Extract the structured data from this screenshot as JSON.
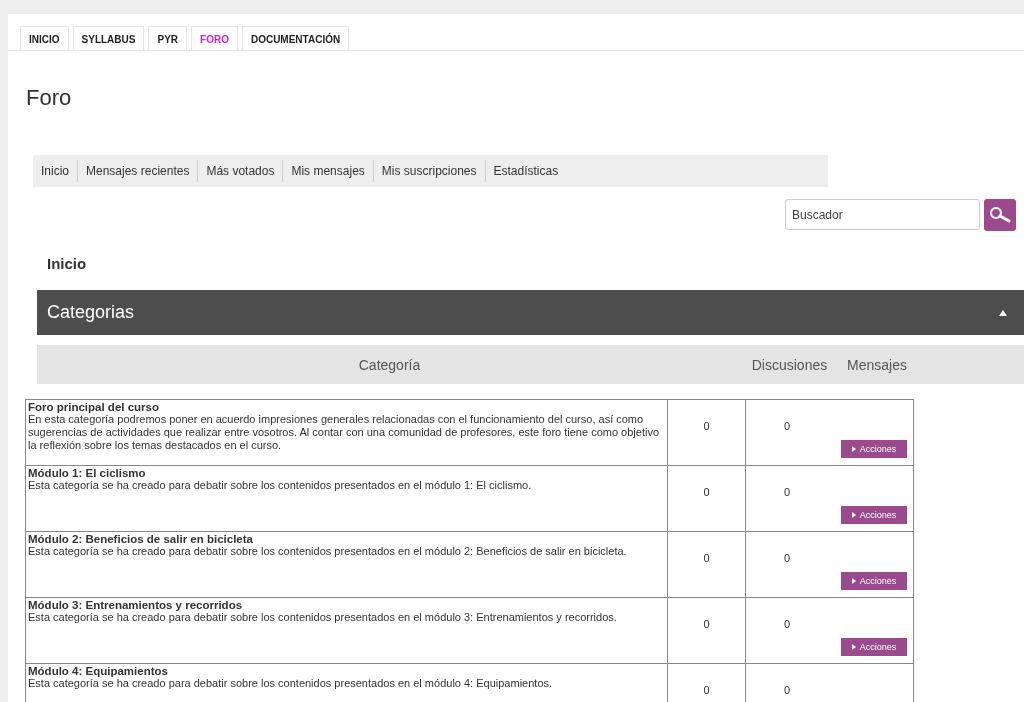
{
  "tabs": [
    {
      "label": "INICIO",
      "selected": false
    },
    {
      "label": "SYLLABUS",
      "selected": false
    },
    {
      "label": "PYR",
      "selected": false
    },
    {
      "label": "FORO",
      "selected": true
    },
    {
      "label": "DOCUMENTACIÓN",
      "selected": false
    }
  ],
  "page_title": "Foro",
  "forum_nav": [
    "Inicio",
    "Mensajes recientes",
    "Más votados",
    "Mis mensajes",
    "Mis suscripciones",
    "Estadísticas"
  ],
  "search": {
    "placeholder": "Buscador"
  },
  "breadcrumb": "Inicio",
  "section": {
    "title": "Categorias",
    "expanded": true
  },
  "table": {
    "columns": [
      "Categoría",
      "Discusiones",
      "Mensajes"
    ],
    "rows": [
      {
        "title": "Foro principal del curso",
        "description": "En esta categoría podremos poner en acuerdo impresiones generales relacionadas con el funcionamiento del curso, así como sugerencias de actividades que realizar entre vosotros. Al contar con una comunidad de profesores, este foro tiene como objetivo la reflexión sobre los temas destacados en el curso.",
        "discussions": "0",
        "messages": "0",
        "action": "Acciones"
      },
      {
        "title": "Módulo 1: El ciclismo",
        "description": "Esta categoría se ha creado para debatir sobre los contenidos presentados en el módulo 1: El ciclismo.",
        "discussions": "0",
        "messages": "0",
        "action": "Acciones"
      },
      {
        "title": "Módulo 2: Beneficios de salir en bicicleta",
        "description": "Esta categoría se ha creado para debatir sobre los contenidos presentados en el módulo 2: Beneficios de salir en bicicleta.",
        "discussions": "0",
        "messages": "0",
        "action": "Acciones"
      },
      {
        "title": "Módulo 3: Entrenamientos y recorridos",
        "description": "Esta categoría se ha creado para debatir sobre los contenidos presentados en el módulo 3: Entrenamientos y recorridos.",
        "discussions": "0",
        "messages": "0",
        "action": "Acciones"
      },
      {
        "title": "Módulo 4: Equipamientos",
        "description": "Esta categoría se ha creado para debatir sobre los contenidos presentados en el módulo 4: Equipamientos.",
        "discussions": "0",
        "messages": "0"
      }
    ]
  }
}
